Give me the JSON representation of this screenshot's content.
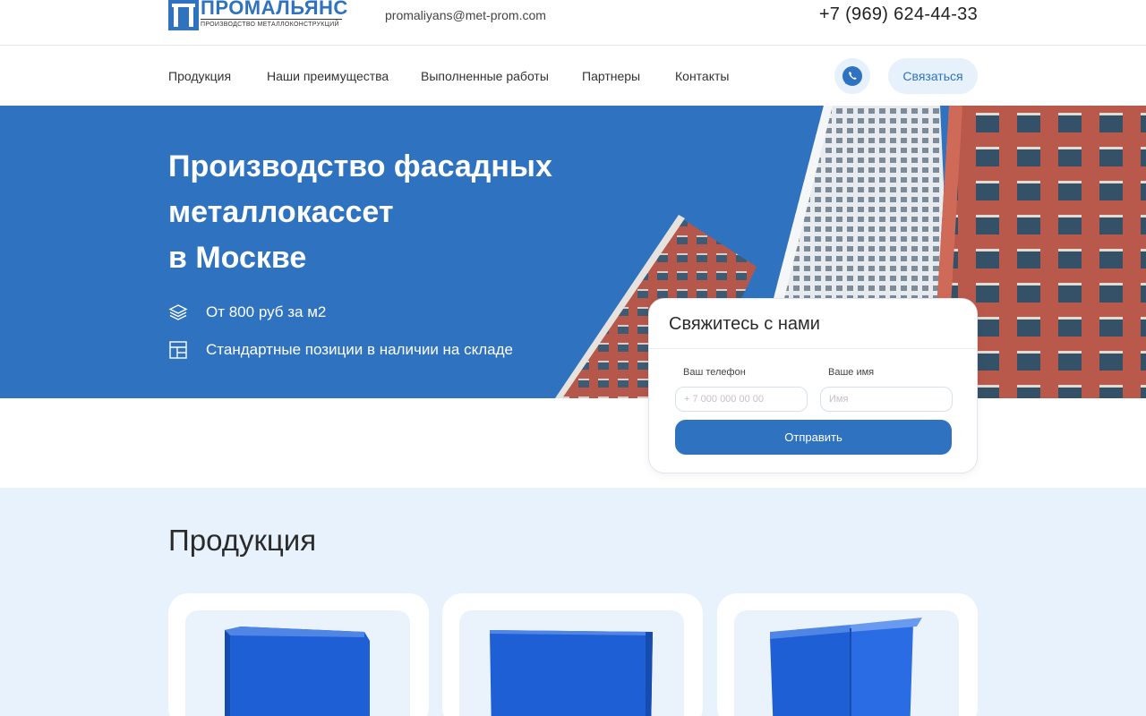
{
  "header": {
    "logo_name": "ПРОМАЛЬЯНС",
    "logo_sub": "ПРОИЗВОДСТВО МЕТАЛЛОКОНСТРУКЦИЙ",
    "email": "promaliyans@met-prom.com",
    "phone": "+7 (969) 624-44-33"
  },
  "nav": {
    "items": [
      "Продукция",
      "Наши преимущества",
      "Выполненные работы",
      "Партнеры",
      "Контакты"
    ],
    "contact_button": "Связаться",
    "whatsapp_icon": "whatsapp-icon"
  },
  "hero": {
    "title_lines": [
      "Производство фасадных",
      "металлокассет",
      "в Москве"
    ],
    "features": [
      {
        "icon": "layers-icon",
        "text": "От 800 руб за м2"
      },
      {
        "icon": "layout-icon",
        "text": "Стандартные позиции в наличии на складе"
      }
    ]
  },
  "form": {
    "title": "Свяжитесь с нами",
    "phone_label": "Ваш телефон",
    "phone_placeholder": "+ 7 000 000 00 00",
    "name_label": "Ваше имя",
    "name_placeholder": "Имя",
    "submit_label": "Отправить"
  },
  "products": {
    "title": "Продукция"
  },
  "colors": {
    "brand": "#2f73c0",
    "light_bg": "#e8f2fc",
    "product_blue": "#1f5fd6"
  }
}
